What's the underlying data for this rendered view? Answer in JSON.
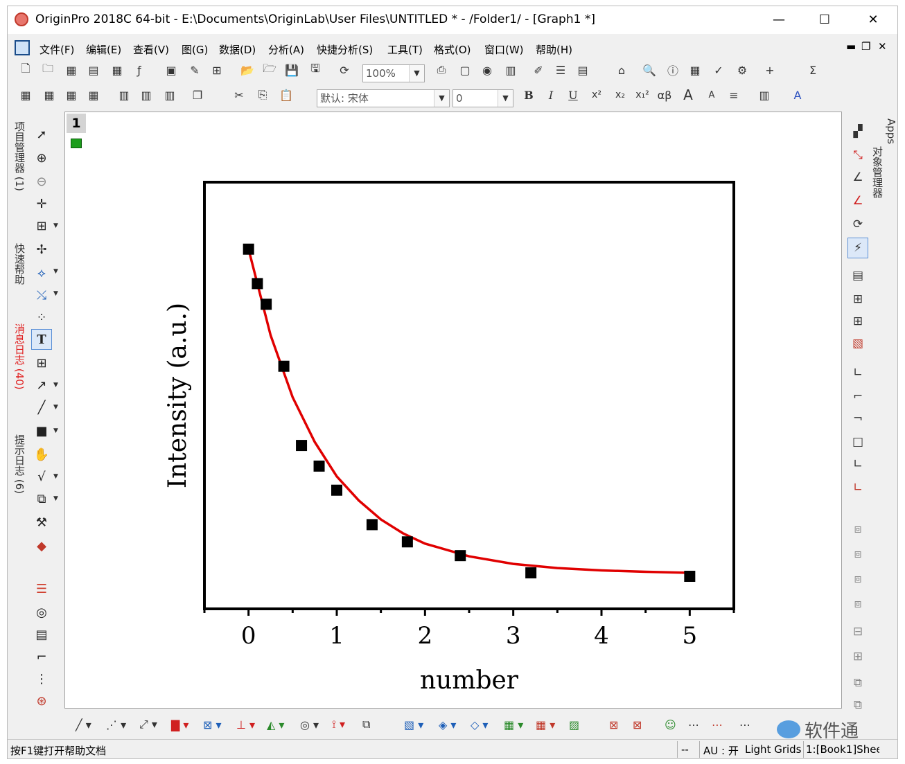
{
  "window": {
    "title": "OriginPro 2018C 64-bit - E:\\Documents\\OriginLab\\User Files\\UNTITLED * - /Folder1/ - [Graph1 *]",
    "min_label": "—",
    "max_label": "☐",
    "close_label": "✕"
  },
  "menu": {
    "items": [
      "文件(F)",
      "编辑(E)",
      "查看(V)",
      "图(G)",
      "数据(D)",
      "分析(A)",
      "快捷分析(S)",
      "工具(T)",
      "格式(O)",
      "窗口(W)",
      "帮助(H)"
    ],
    "mdi_min": "▬",
    "mdi_restore": "❐",
    "mdi_close": "✕"
  },
  "toolbar": {
    "zoom_value": "100%",
    "font_value": "默认: 宋体",
    "font_size_value": "0",
    "bold_label": "B",
    "italic_label": "I",
    "underline_label": "U",
    "superscript_label": "x²",
    "subscript_label": "x₂",
    "supsub_label": "x₁²",
    "greek_label": "αβ",
    "increase_font_label": "A",
    "decrease_font_label": "A",
    "sum_label": "Σ"
  },
  "left_tabs": [
    {
      "label": "项目管理器 (1)",
      "color": "#333333"
    },
    {
      "label": "快速帮助",
      "color": "#333333"
    },
    {
      "label": "消息日志 (40)",
      "color": "#e02020"
    },
    {
      "label": "提示日志 (6)",
      "color": "#333333"
    }
  ],
  "right_tabs": {
    "apps": "Apps",
    "object_manager": "对象管理器"
  },
  "graph": {
    "layer_number": "1"
  },
  "chart_data": {
    "type": "scatter",
    "xlabel": "number",
    "ylabel": "Intensity (a.u.)",
    "xlim": [
      -0.5,
      5.5
    ],
    "ylim": [
      0,
      1.05
    ],
    "xticks": [
      "0",
      "1",
      "2",
      "3",
      "4",
      "5"
    ],
    "show_y_tick_labels": false,
    "grid": false,
    "legend": "none",
    "series": [
      {
        "kind": "points",
        "color": "#000000",
        "marker": "square",
        "x": [
          0.0,
          0.1,
          0.2,
          0.4,
          0.6,
          0.8,
          1.0,
          1.4,
          1.8,
          2.4,
          3.2,
          5.0
        ],
        "y": [
          0.95,
          0.85,
          0.79,
          0.61,
          0.38,
          0.32,
          0.25,
          0.15,
          0.1,
          0.06,
          0.01,
          0.0
        ]
      },
      {
        "kind": "fit",
        "color": "#e00000",
        "model": "exponential decay",
        "x": [
          0.0,
          0.25,
          0.5,
          0.75,
          1.0,
          1.25,
          1.5,
          1.75,
          2.0,
          2.5,
          3.0,
          3.5,
          4.0,
          4.5,
          5.0
        ],
        "y": [
          0.95,
          0.7,
          0.52,
          0.39,
          0.29,
          0.22,
          0.165,
          0.125,
          0.095,
          0.058,
          0.036,
          0.024,
          0.017,
          0.013,
          0.01
        ]
      }
    ]
  },
  "statusbar": {
    "help_text": "按F1键打开帮助文档",
    "dashes": "--",
    "au_text": "AU : 开",
    "theme_text": "Light Grids",
    "book_text": "1:[Book1]Shee"
  },
  "watermark": {
    "text": "软件通"
  }
}
